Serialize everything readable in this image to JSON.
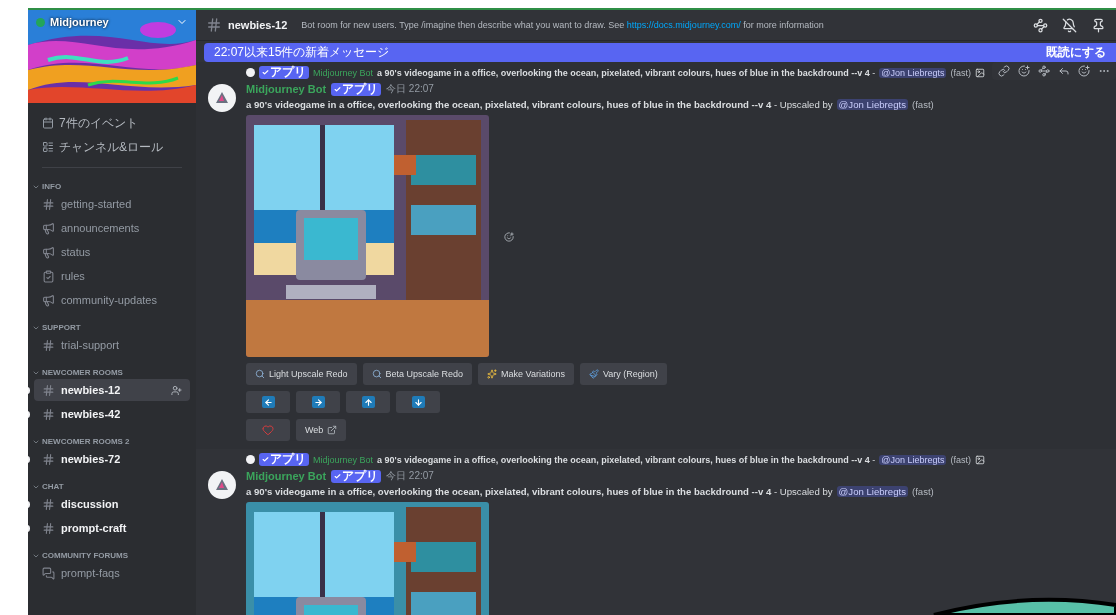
{
  "server": {
    "name": "Midjourney",
    "online": true
  },
  "sidebar": {
    "links": [
      {
        "label": "7件のイベント"
      },
      {
        "label": "チャンネル&ロール"
      }
    ],
    "categories": [
      {
        "name": "INFO",
        "expanded": true,
        "channels": [
          {
            "name": "getting-started",
            "kind": "text",
            "unread": false,
            "selected": false
          },
          {
            "name": "announcements",
            "kind": "announce",
            "unread": false,
            "selected": false
          },
          {
            "name": "status",
            "kind": "announce",
            "unread": false,
            "selected": false
          },
          {
            "name": "rules",
            "kind": "rules",
            "unread": false,
            "selected": false
          },
          {
            "name": "community-updates",
            "kind": "announce",
            "unread": false,
            "selected": false
          }
        ]
      },
      {
        "name": "SUPPORT",
        "expanded": true,
        "channels": [
          {
            "name": "trial-support",
            "kind": "text",
            "unread": false,
            "selected": false
          }
        ]
      },
      {
        "name": "NEWCOMER ROOMS",
        "expanded": true,
        "channels": [
          {
            "name": "newbies-12",
            "kind": "thread",
            "unread": true,
            "selected": true
          },
          {
            "name": "newbies-42",
            "kind": "thread",
            "unread": true,
            "selected": false
          }
        ]
      },
      {
        "name": "NEWCOMER ROOMS 2",
        "expanded": true,
        "channels": [
          {
            "name": "newbies-72",
            "kind": "thread",
            "unread": true,
            "selected": false
          }
        ]
      },
      {
        "name": "CHAT",
        "expanded": true,
        "channels": [
          {
            "name": "discussion",
            "kind": "text",
            "unread": true,
            "selected": false
          },
          {
            "name": "prompt-craft",
            "kind": "text",
            "unread": true,
            "selected": false
          }
        ]
      },
      {
        "name": "COMMUNITY FORUMS",
        "expanded": true,
        "channels": [
          {
            "name": "prompt-faqs",
            "kind": "forum",
            "unread": false,
            "selected": false
          }
        ]
      }
    ]
  },
  "channel": {
    "name": "newbies-12",
    "topic": "Bot room for new users. Type /imagine then describe what you want to draw. See",
    "topic_link": "https://docs.midjourney.com/",
    "topic_after": "for more information"
  },
  "new_messages_bar": {
    "text": "22:07以来15件の新着メッセージ",
    "action": "既読にする"
  },
  "messages": [
    {
      "hovered": true,
      "reply": {
        "badge": "アプリ",
        "author": "Midjourney Bot",
        "text": "**a 90's videogame in a office, overlooking the ocean, pixelated, vibrant colours, hues of blue in the backdround --v 4** -",
        "mention": "@Jon Liebregts",
        "suffix": "(fast)"
      },
      "author": "Midjourney Bot",
      "badge": "アプリ",
      "time": "今日 22:07",
      "content": "**a 90's videogame in a office, overlooking the ocean, pixelated, vibrant colours, hues of blue in the backdround --v 4** - Upscaled by",
      "mention": "@Jon Liebregts",
      "suffix": "(fast)",
      "image": {
        "kind": "picture"
      },
      "button_rows": [
        [
          {
            "kind": "action",
            "label": "Light Upscale Redo"
          },
          {
            "kind": "action",
            "label": "Beta Upscale Redo"
          },
          {
            "kind": "action",
            "label": "Make Variations"
          },
          {
            "kind": "action",
            "label": "Vary (Region)"
          }
        ],
        [
          {
            "kind": "arrow"
          },
          {
            "kind": "arrow"
          },
          {
            "kind": "arrow"
          },
          {
            "kind": "arrow"
          }
        ],
        [
          {
            "kind": "reaction"
          },
          {
            "kind": "link",
            "label": "Web"
          }
        ]
      ]
    },
    {
      "hovered": false,
      "reply": {
        "badge": "アプリ",
        "author": "Midjourney Bot",
        "text": "**a 90's videogame in a office, overlooking the ocean, pixelated, vibrant colours, hues of blue in the backdround --v 4** -",
        "mention": "@Jon Liebregts",
        "suffix": "(fast)"
      },
      "author": "Midjourney Bot",
      "badge": "アプリ",
      "time": "今日 22:07",
      "content": "**a 90's videogame in a office, overlooking the ocean, pixelated, vibrant colours, hues of blue in the backdround --v 4** - Upscaled by",
      "mention": "@Jon Liebregts",
      "suffix": "(fast)",
      "image": {
        "kind": "picture"
      }
    }
  ]
}
